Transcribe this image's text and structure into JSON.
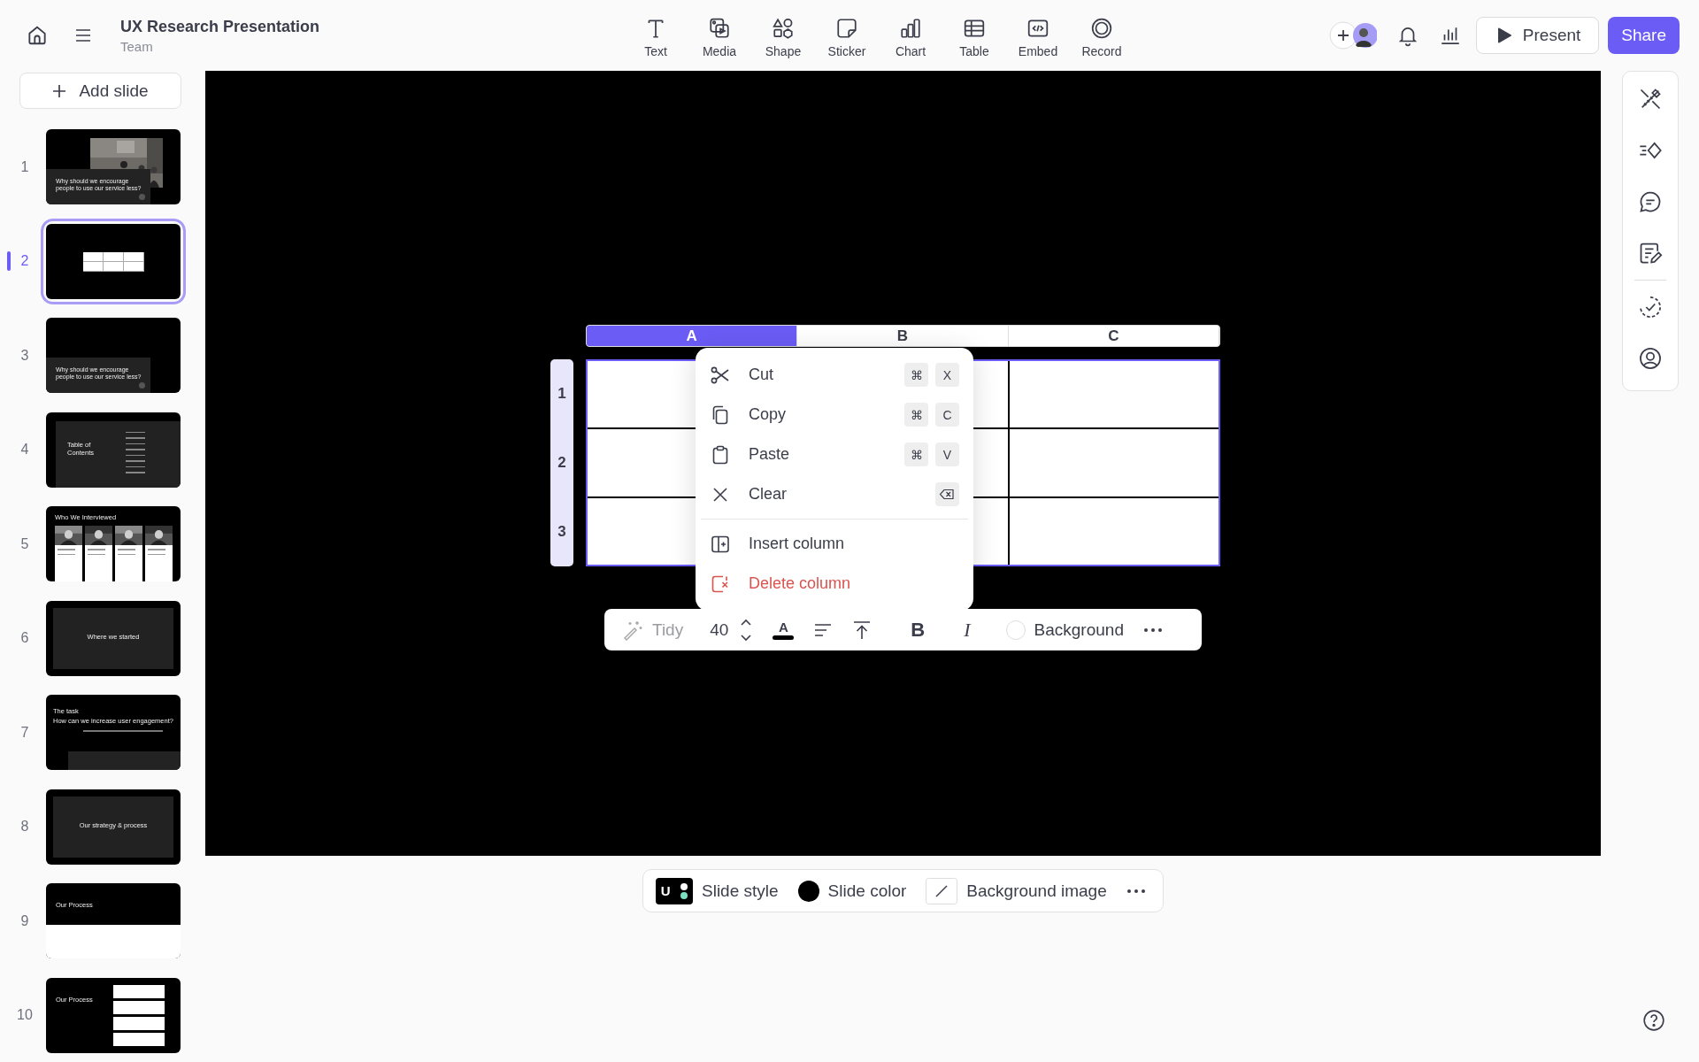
{
  "document": {
    "title": "UX Research Presentation",
    "subtitle": "Team"
  },
  "insert_tools": [
    {
      "kind": "text",
      "label": "Text"
    },
    {
      "kind": "media",
      "label": "Media"
    },
    {
      "kind": "shape",
      "label": "Shape"
    },
    {
      "kind": "sticker",
      "label": "Sticker"
    },
    {
      "kind": "chart",
      "label": "Chart"
    },
    {
      "kind": "table",
      "label": "Table"
    },
    {
      "kind": "embed",
      "label": "Embed"
    },
    {
      "kind": "record",
      "label": "Record"
    }
  ],
  "header_actions": {
    "present": "Present",
    "share": "Share"
  },
  "add_slide": "Add slide",
  "slides": [
    {
      "number": "1",
      "selected": false,
      "kind": "cover",
      "photo": true,
      "title": "Why should we encourage people to use our service less?"
    },
    {
      "number": "2",
      "selected": true,
      "kind": "table"
    },
    {
      "number": "3",
      "selected": false,
      "kind": "cover",
      "photo": false,
      "title": "Why should we encourage people to use our service less?"
    },
    {
      "number": "4",
      "selected": false,
      "kind": "toc",
      "title": "Table of Contents"
    },
    {
      "number": "5",
      "selected": false,
      "kind": "people",
      "title": "Who We Interviewed"
    },
    {
      "number": "6",
      "selected": false,
      "kind": "section",
      "title": "Where we started"
    },
    {
      "number": "7",
      "selected": false,
      "kind": "task",
      "label": "The task",
      "title": "How can we increase user engagement?"
    },
    {
      "number": "8",
      "selected": false,
      "kind": "section",
      "title": "Our strategy & process"
    },
    {
      "number": "9",
      "selected": false,
      "kind": "process",
      "title": "Our Process"
    },
    {
      "number": "10",
      "selected": false,
      "kind": "steps",
      "title": "Our Process"
    }
  ],
  "table": {
    "columns": [
      {
        "label": "A",
        "selected": true
      },
      {
        "label": "B",
        "selected": false
      },
      {
        "label": "C",
        "selected": false
      }
    ],
    "rows": [
      {
        "label": "1"
      },
      {
        "label": "2"
      },
      {
        "label": "3"
      }
    ]
  },
  "context_menu": {
    "groups": [
      [
        {
          "kind": "cut",
          "label": "Cut",
          "keys": [
            "⌘",
            "X"
          ],
          "danger": false
        },
        {
          "kind": "copy",
          "label": "Copy",
          "keys": [
            "⌘",
            "C"
          ],
          "danger": false
        },
        {
          "kind": "paste",
          "label": "Paste",
          "keys": [
            "⌘",
            "V"
          ],
          "danger": false
        },
        {
          "kind": "clear",
          "label": "Clear",
          "backspace_key": true,
          "danger": false
        }
      ],
      [
        {
          "kind": "insert",
          "label": "Insert column",
          "danger": false
        },
        {
          "kind": "delete",
          "label": "Delete column",
          "danger": true
        }
      ]
    ]
  },
  "format_toolbar": {
    "tidy": "Tidy",
    "tidy_disabled": true,
    "font_size": "40",
    "text_color_label": "A",
    "bold_label": "B",
    "italic_label": "I",
    "background": "Background"
  },
  "slide_bar": {
    "style_letter": "U",
    "style": "Slide style",
    "color_label": "Slide color",
    "background_image": "Background image"
  }
}
